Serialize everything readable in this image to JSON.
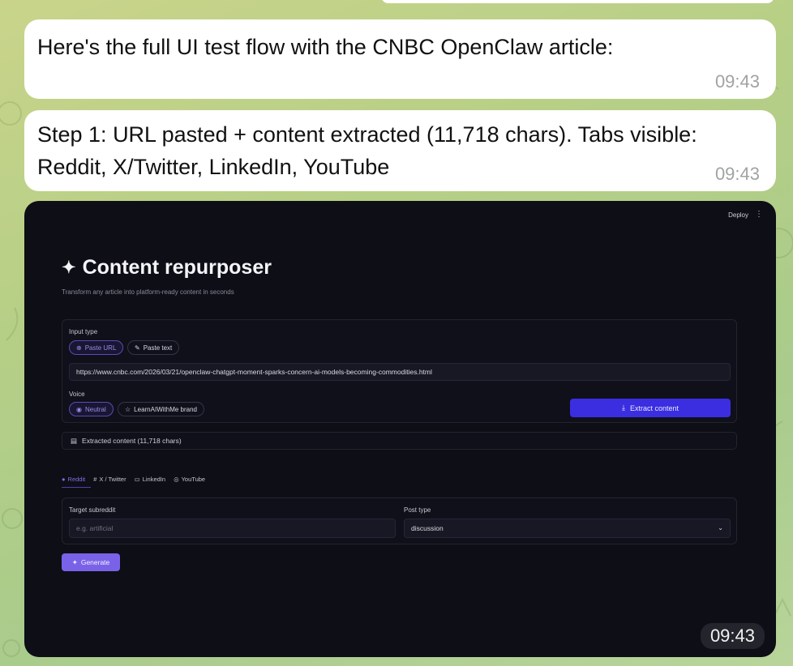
{
  "messages": [
    {
      "text": "Here's the full UI test flow with the CNBC OpenClaw article:",
      "time": "09:43"
    },
    {
      "text": "Step 1: URL pasted + content extracted (11,718 chars). Tabs visible: Reddit, X/Twitter, LinkedIn, YouTube",
      "time": "09:43"
    }
  ],
  "screenshot": {
    "time": "09:43",
    "header": {
      "deploy": "Deploy",
      "menu_icon": "⋮"
    },
    "app": {
      "title": "Content repurposer",
      "subtitle": "Transform any article into platform-ready content in seconds",
      "input_type_label": "Input type",
      "input_types": {
        "url": "Paste URL",
        "text": "Paste text"
      },
      "url_value": "https://www.cnbc.com/2026/03/21/openclaw-chatgpt-moment-sparks-concern-ai-models-becoming-commodities.html",
      "voice_label": "Voice",
      "voices": {
        "neutral": "Neutral",
        "brand": "LearnAIWithMe brand"
      },
      "extract_button": "Extract content",
      "extracted_label": "Extracted content (11,718 chars)",
      "tabs": {
        "reddit": "Reddit",
        "x": "X / Twitter",
        "linkedin": "LinkedIn",
        "youtube": "YouTube"
      },
      "target_subreddit_label": "Target subreddit",
      "target_subreddit_placeholder": "e.g. artificial",
      "post_type_label": "Post type",
      "post_type_value": "discussion",
      "generate_button": "Generate"
    }
  },
  "colors": {
    "accent": "#3a2ee0",
    "generate": "#7a62e8",
    "tab_active": "#7f6fe6"
  }
}
